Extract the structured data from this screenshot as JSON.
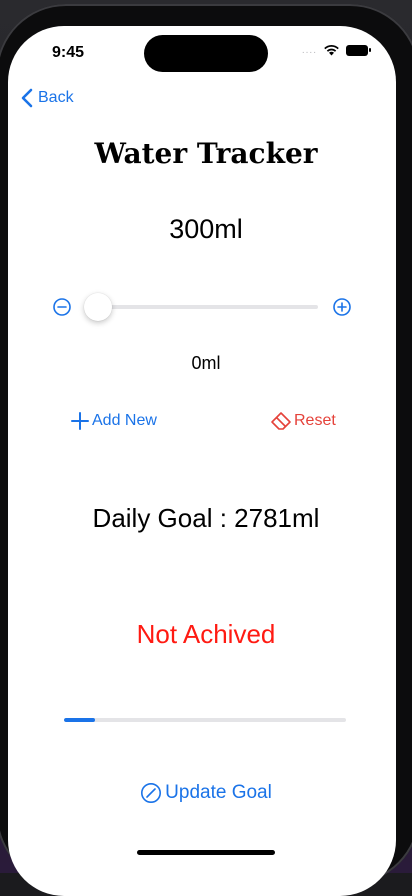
{
  "status_bar": {
    "time": "9:45",
    "signal": "....",
    "wifi_icon": "wifi-icon",
    "battery_icon": "battery-icon"
  },
  "nav": {
    "back_label": "Back",
    "back_icon": "chevron-left-icon"
  },
  "header": {
    "title": "Water Tracker"
  },
  "intake": {
    "amount": "300ml"
  },
  "slider": {
    "min_icon": "minus-circle-icon",
    "max_icon": "plus-circle-icon",
    "value": 0,
    "value_label": "0ml"
  },
  "actions": {
    "add_label": "Add New",
    "add_icon": "plus-icon",
    "reset_label": "Reset",
    "reset_icon": "eraser-icon"
  },
  "goal": {
    "text": "Daily Goal : 2781ml"
  },
  "status": {
    "text": "Not Achived"
  },
  "progress": {
    "fraction": 0.11
  },
  "footer": {
    "update_label": "Update Goal",
    "update_icon": "pencil-circle-icon"
  },
  "colors": {
    "accent": "#1a73e8",
    "danger": "#ff1a12",
    "reset": "#e5423a"
  }
}
